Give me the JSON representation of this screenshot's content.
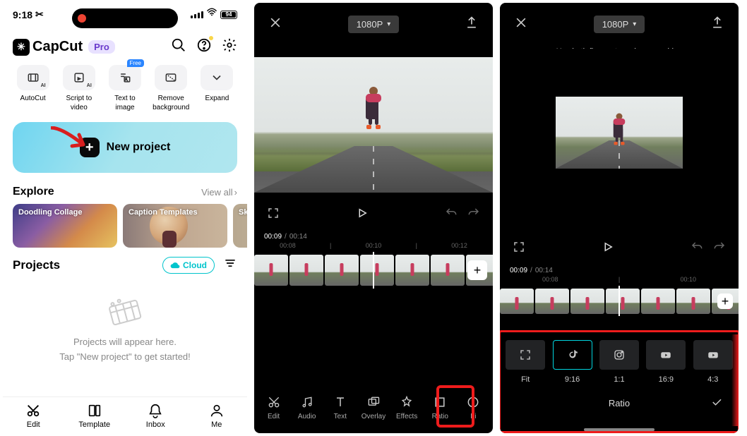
{
  "status": {
    "time": "9:18",
    "battery": "94"
  },
  "header": {
    "app_name": "CapCut",
    "pro_label": "Pro",
    "search_icon": "search-icon",
    "help_icon": "help-icon",
    "settings_icon": "settings-icon"
  },
  "tools": [
    {
      "label": "AutoCut",
      "icon": "autocut-icon"
    },
    {
      "label": "Script to video",
      "icon": "script-icon"
    },
    {
      "label": "Text to image",
      "icon": "textimg-icon",
      "tag": "Free"
    },
    {
      "label": "Remove background",
      "icon": "removebg-icon"
    },
    {
      "label": "Expand",
      "icon": "expand-icon"
    }
  ],
  "new_project_label": "New project",
  "explore": {
    "title": "Explore",
    "view_all": "View all",
    "cards": [
      {
        "label": "Doodling Collage"
      },
      {
        "label": "Caption Templates"
      },
      {
        "label": "Skin Filter"
      }
    ]
  },
  "projects": {
    "title": "Projects",
    "cloud_label": "Cloud",
    "placeholder_line1": "Projects will appear here.",
    "placeholder_line2": "Tap \"New project\" to get started!"
  },
  "bottom_nav": [
    {
      "label": "Edit"
    },
    {
      "label": "Template"
    },
    {
      "label": "Inbox"
    },
    {
      "label": "Me"
    }
  ],
  "editor": {
    "resolution": "1080P",
    "time_current": "00:09",
    "time_total": "00:14",
    "ticks": [
      "00:08",
      "00:10",
      "00:12"
    ],
    "tools": [
      {
        "label": "Edit"
      },
      {
        "label": "Audio"
      },
      {
        "label": "Text"
      },
      {
        "label": "Overlay"
      },
      {
        "label": "Effects"
      },
      {
        "label": "Ratio"
      },
      {
        "label": "Fi"
      }
    ]
  },
  "ratio": {
    "hint": "Use both fingers to resize your video",
    "resolution": "1080P",
    "time_current": "00:09",
    "time_total": "00:14",
    "ticks": [
      "00:08",
      "00:10"
    ],
    "title": "Ratio",
    "options": [
      {
        "label": "Fit",
        "icon": "fit-icon"
      },
      {
        "label": "9:16",
        "icon": "tiktok-icon",
        "selected": true
      },
      {
        "label": "1:1",
        "icon": "instagram-icon"
      },
      {
        "label": "16:9",
        "icon": "youtube-icon"
      },
      {
        "label": "4:3",
        "icon": "youtube-icon"
      }
    ]
  }
}
